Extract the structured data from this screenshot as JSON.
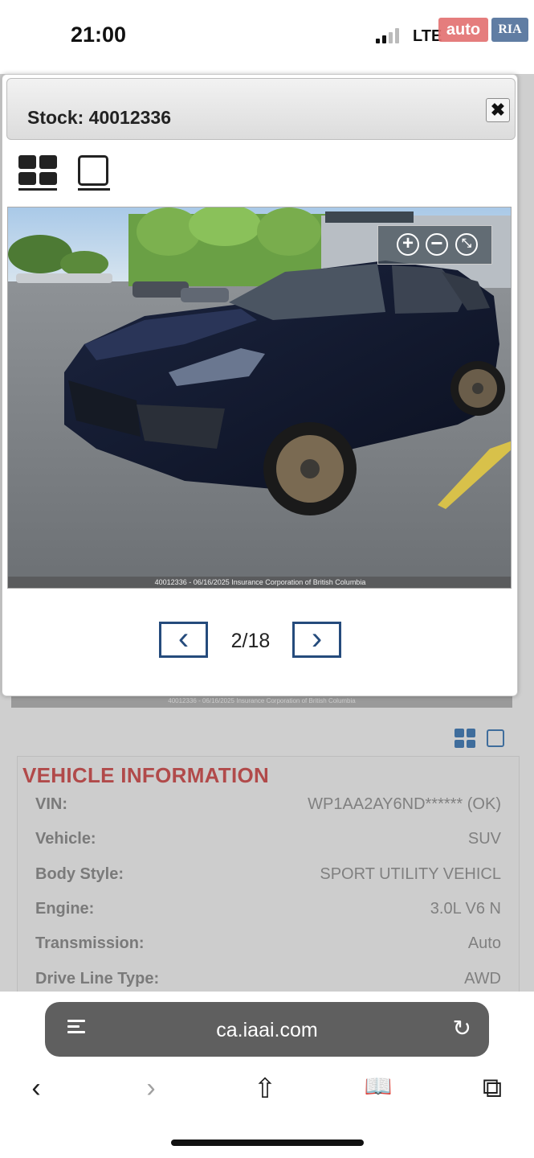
{
  "status_bar": {
    "time": "21:00",
    "network": "LTE",
    "watermark_auto": "auto",
    "watermark_ria": "RIA"
  },
  "modal": {
    "title": "Stock: 40012336",
    "close_label": "✖",
    "photo_caption": "40012336 - 06/16/2025 Insurance Corporation of British Columbia",
    "zoom": {
      "in": "+",
      "out": "−",
      "fit": "⤡"
    },
    "pager": {
      "prev": "‹",
      "next": "›",
      "text": "2/18"
    }
  },
  "background": {
    "caption_strip": "40012336 - 06/16/2025 Insurance Corporation of British Columbia",
    "section_title": "VEHICLE INFORMATION",
    "rows": [
      {
        "label": "VIN:",
        "value": "WP1AA2AY6ND****** (OK)"
      },
      {
        "label": "Vehicle:",
        "value": "SUV"
      },
      {
        "label": "Body Style:",
        "value": "SPORT UTILITY VEHICL"
      },
      {
        "label": "Engine:",
        "value": "3.0L V6 N"
      },
      {
        "label": "Transmission:",
        "value": "Auto"
      },
      {
        "label": "Drive Line Type:",
        "value": "AWD"
      }
    ]
  },
  "browser": {
    "url": "ca.iaai.com",
    "reload": "↻",
    "back": "‹",
    "forward": "›",
    "share": "⇧",
    "bookmarks": "📖",
    "tabs": "⧉"
  }
}
